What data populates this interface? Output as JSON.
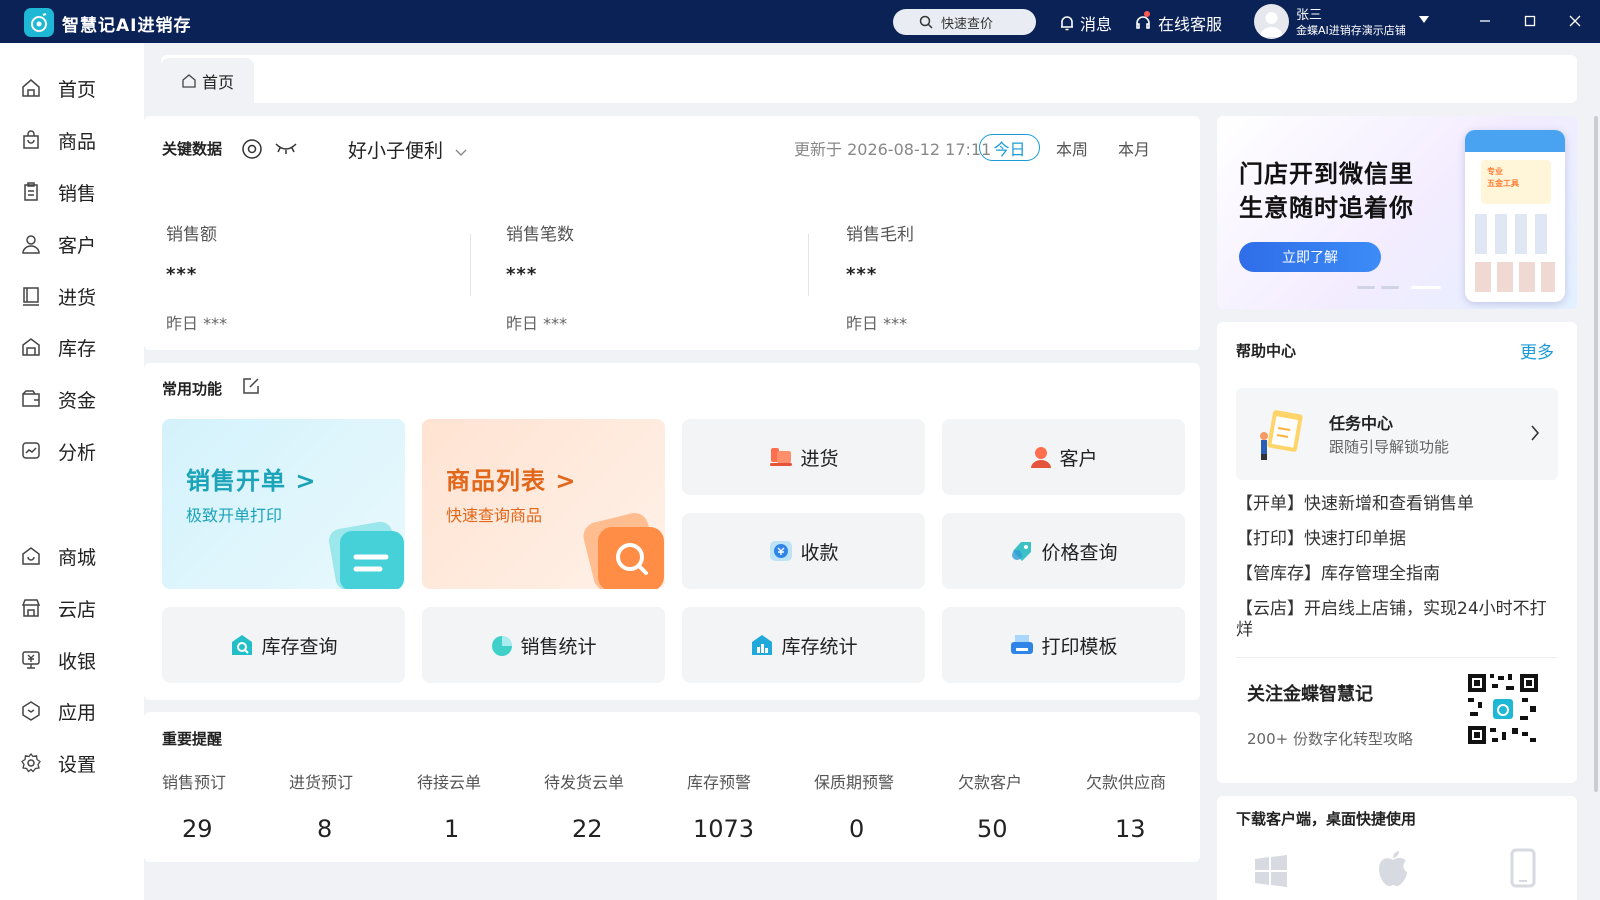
{
  "app": {
    "name": "智慧记AI进销存"
  },
  "topbar": {
    "search_label": "快速查价",
    "message_label": "消息",
    "service_label": "在线客服",
    "user_name": "张三",
    "user_store": "金蝶AI进销存演示店铺"
  },
  "sidebar": {
    "items": [
      {
        "label": "首页",
        "icon": "home-icon"
      },
      {
        "label": "商品",
        "icon": "bag-icon"
      },
      {
        "label": "销售",
        "icon": "clipboard-icon"
      },
      {
        "label": "客户",
        "icon": "user-icon"
      },
      {
        "label": "进货",
        "icon": "book-icon"
      },
      {
        "label": "库存",
        "icon": "warehouse-icon"
      },
      {
        "label": "资金",
        "icon": "wallet-icon"
      },
      {
        "label": "分析",
        "icon": "chart-icon"
      },
      {
        "label": "商城",
        "icon": "shop-icon"
      },
      {
        "label": "云店",
        "icon": "store-icon"
      },
      {
        "label": "收银",
        "icon": "cashier-icon"
      },
      {
        "label": "应用",
        "icon": "app-icon"
      },
      {
        "label": "设置",
        "icon": "gear-icon"
      }
    ]
  },
  "tabs": [
    {
      "label": "首页"
    }
  ],
  "key_data": {
    "title": "关键数据",
    "store": "好小子便利",
    "updated": "更新于 2026-08-12 17:11",
    "periods": [
      "今日",
      "本周",
      "本月"
    ],
    "metrics": [
      {
        "label": "销售额",
        "value": "***",
        "yesterday": "昨日 ***"
      },
      {
        "label": "销售笔数",
        "value": "***",
        "yesterday": "昨日 ***"
      },
      {
        "label": "销售毛利",
        "value": "***",
        "yesterday": "昨日 ***"
      }
    ]
  },
  "common": {
    "title": "常用功能",
    "big": [
      {
        "title": "销售开单 >",
        "sub": "极致开单打印"
      },
      {
        "title": "商品列表 >",
        "sub": "快速查询商品"
      }
    ],
    "tiles": [
      {
        "label": "进货",
        "icon": "purchase-icon"
      },
      {
        "label": "客户",
        "icon": "customer-icon"
      },
      {
        "label": "收款",
        "icon": "payment-icon"
      },
      {
        "label": "价格查询",
        "icon": "price-tag-icon"
      },
      {
        "label": "库存查询",
        "icon": "inventory-search-icon"
      },
      {
        "label": "销售统计",
        "icon": "pie-chart-icon"
      },
      {
        "label": "库存统计",
        "icon": "bar-chart-icon"
      },
      {
        "label": "打印模板",
        "icon": "printer-icon"
      }
    ]
  },
  "reminders": {
    "title": "重要提醒",
    "items": [
      {
        "label": "销售预订",
        "value": "29"
      },
      {
        "label": "进货预订",
        "value": "8"
      },
      {
        "label": "待接云单",
        "value": "1"
      },
      {
        "label": "待发货云单",
        "value": "22"
      },
      {
        "label": "库存预警",
        "value": "1073"
      },
      {
        "label": "保质期预警",
        "value": "0"
      },
      {
        "label": "欠款客户",
        "value": "50"
      },
      {
        "label": "欠款供应商",
        "value": "13"
      }
    ]
  },
  "banner": {
    "line1": "门店开到微信里",
    "line2": "生意随时追着你",
    "button": "立即了解",
    "phone_text1": "专业",
    "phone_text2": "五金工具"
  },
  "help": {
    "title": "帮助中心",
    "more": "更多",
    "task_title": "任务中心",
    "task_sub": "跟随引导解锁功能",
    "items": [
      "【开单】快速新增和查看销售单",
      "【打印】快速打印单据",
      "【管库存】库存管理全指南",
      "【云店】开启线上店铺，实现24小时不打烊"
    ],
    "follow_title": "关注金蝶智慧记",
    "follow_sub": "200+ 份数字化转型攻略"
  },
  "download": {
    "title": "下载客户端，桌面快捷使用"
  },
  "colors": {
    "topbar": "#0b2257",
    "accent": "#1a9bd6",
    "teal": "#1ba3b9",
    "orange": "#e1671b"
  }
}
